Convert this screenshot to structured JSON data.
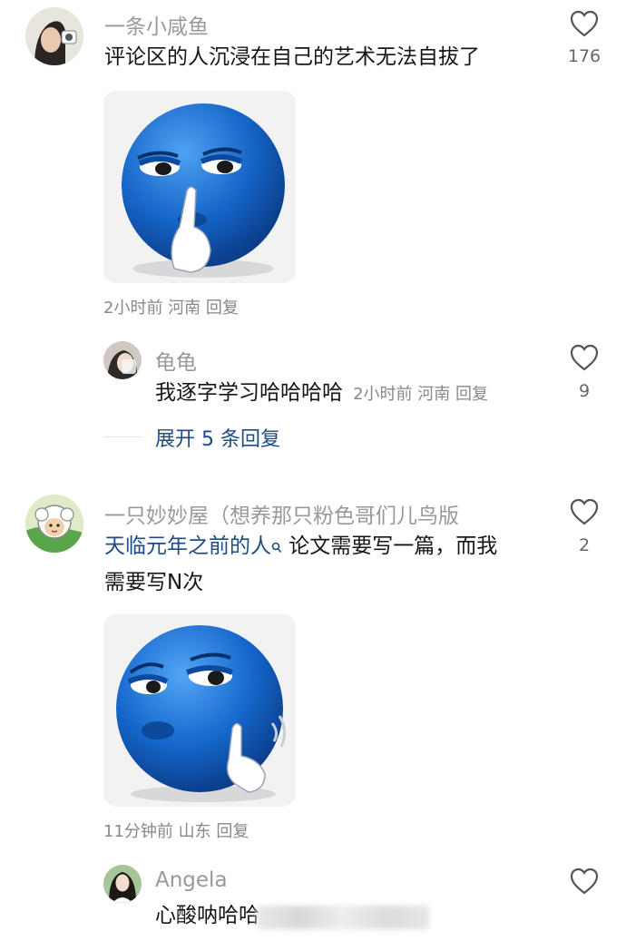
{
  "comments": [
    {
      "username": "一条小咸鱼",
      "text": "评论区的人沉浸在自己的艺术无法自拔了",
      "likes": "176",
      "meta": "2小时前 河南 回复",
      "avatar_icon": "woman-with-camera-avatar",
      "sticker_icon": "blue-face-shush-sticker"
    },
    {
      "username": "一只妙妙屋（想养那只粉色哥们儿鸟版",
      "text_link": "天临元年之前的人",
      "text_rest_1": " 论文需要写一篇，而我",
      "text_rest_2": "需要写N次",
      "likes": "2",
      "meta": "11分钟前 山东 回复",
      "avatar_icon": "cartoon-sheep-avatar",
      "sticker_icon": "blue-face-thinking-sticker"
    }
  ],
  "replies": [
    {
      "username": "龟龟",
      "text": "我逐字学习哈哈哈哈",
      "meta": "2小时前 河南 回复",
      "likes": "9",
      "avatar_icon": "person-avatar"
    },
    {
      "username": "Angela",
      "text": "心酸呐哈哈",
      "avatar_icon": "woman-avatar"
    }
  ],
  "expand_label": "展开 5 条回复",
  "colors": {
    "link": "#1f4b84",
    "meta": "#888888",
    "sticker_blue": "#1565c8"
  }
}
